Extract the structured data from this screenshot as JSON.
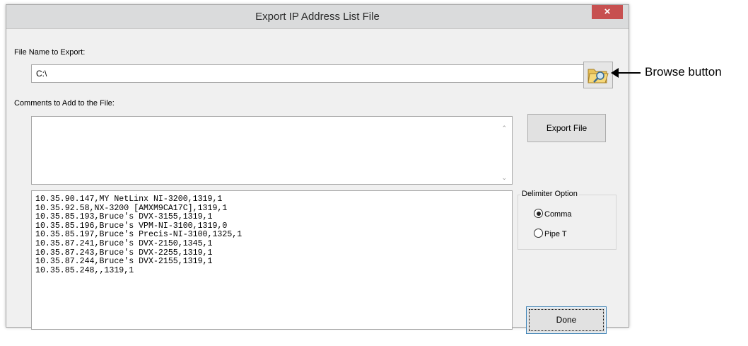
{
  "window": {
    "title": "Export IP Address List File",
    "close_symbol": "×"
  },
  "file_name": {
    "label": "File Name to Export:",
    "value": "C:\\"
  },
  "browse": {
    "icon": "folder-search-icon"
  },
  "comments": {
    "label": "Comments to Add to the File:",
    "value": ""
  },
  "buttons": {
    "export_label": "Export File",
    "done_label": "Done"
  },
  "ip_list": [
    "10.35.90.147,MY NetLinx NI-3200,1319,1",
    "10.35.92.58,NX-3200 [AMXM9CA17C],1319,1",
    "10.35.85.193,Bruce's DVX-3155,1319,1",
    "10.35.85.196,Bruce's VPM-NI-3100,1319,0",
    "10.35.85.197,Bruce's Precis-NI-3100,1325,1",
    "10.35.87.241,Bruce's DVX-2150,1345,1",
    "10.35.87.243,Bruce's DVX-2255,1319,1",
    "10.35.87.244,Bruce's DVX-2155,1319,1",
    "10.35.85.248,,1319,1"
  ],
  "delimiter": {
    "legend": "Delimiter Option",
    "comma_label": "Comma",
    "pipe_label": "Pipe T",
    "selected": "Comma"
  },
  "callout": {
    "label": "Browse button"
  },
  "colors": {
    "close_button": "#c75050",
    "dialog_background": "#f0f0f0"
  }
}
